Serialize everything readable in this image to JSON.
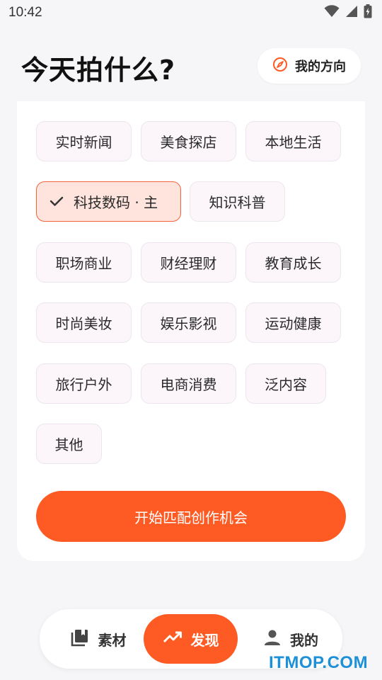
{
  "status_bar": {
    "time": "10:42",
    "icons": [
      "wifi-icon",
      "signal-icon",
      "battery-charging-icon"
    ]
  },
  "header": {
    "title": "今天拍什么?",
    "direction_button": {
      "label": "我的方向",
      "icon": "compass-icon"
    }
  },
  "categories": [
    {
      "label": "实时新闻",
      "selected": false
    },
    {
      "label": "美食探店",
      "selected": false
    },
    {
      "label": "本地生活",
      "selected": false
    },
    {
      "label": "科技数码 · 主",
      "selected": true
    },
    {
      "label": "知识科普",
      "selected": false
    },
    {
      "label": "职场商业",
      "selected": false
    },
    {
      "label": "财经理财",
      "selected": false
    },
    {
      "label": "教育成长",
      "selected": false
    },
    {
      "label": "时尚美妆",
      "selected": false
    },
    {
      "label": "娱乐影视",
      "selected": false
    },
    {
      "label": "运动健康",
      "selected": false
    },
    {
      "label": "旅行户外",
      "selected": false
    },
    {
      "label": "电商消费",
      "selected": false
    },
    {
      "label": "泛内容",
      "selected": false
    },
    {
      "label": "其他",
      "selected": false
    }
  ],
  "start_button": {
    "label": "开始匹配创作机会"
  },
  "bottom_nav": [
    {
      "label": "素材",
      "icon": "library-icon",
      "active": false
    },
    {
      "label": "发现",
      "icon": "trending-up-icon",
      "active": true
    },
    {
      "label": "我的",
      "icon": "person-icon",
      "active": false
    }
  ],
  "watermark": "ITMOP.COM",
  "colors": {
    "accent": "#fe5a24",
    "selected_chip_bg": "#fee4dc",
    "chip_bg": "#fcf6fb",
    "background": "#f6f6f8"
  }
}
